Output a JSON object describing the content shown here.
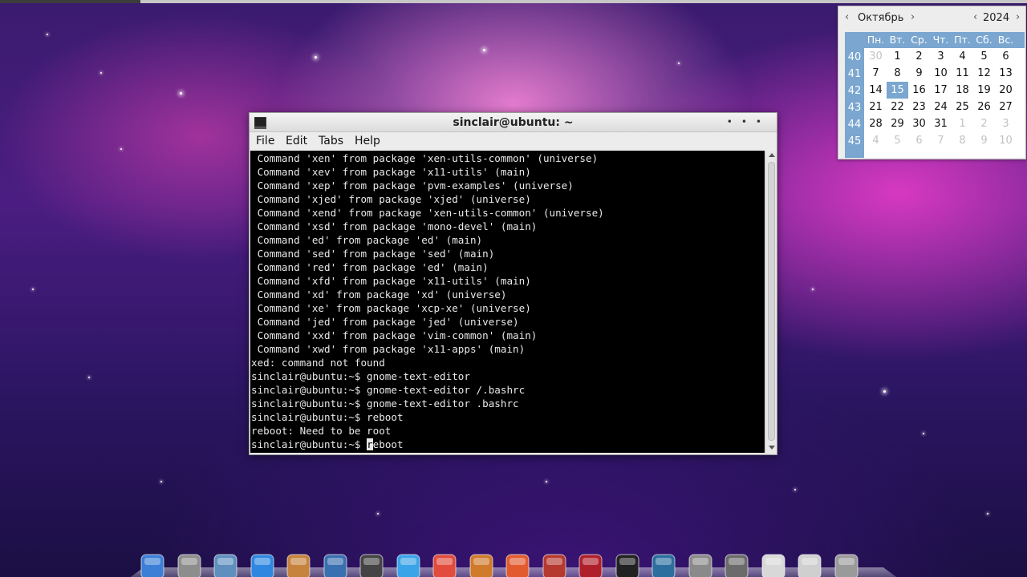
{
  "calendar": {
    "month": "Октябрь",
    "year": "2024",
    "prev_label": "‹",
    "next_label": "›",
    "weekdays": [
      "Пн.",
      "Вт.",
      "Ср.",
      "Чт.",
      "Пт.",
      "Сб.",
      "Вс."
    ],
    "week_numbers": [
      "40",
      "41",
      "42",
      "43",
      "44",
      "45"
    ],
    "rows": [
      [
        "30",
        "1",
        "2",
        "3",
        "4",
        "5",
        "6"
      ],
      [
        "7",
        "8",
        "9",
        "10",
        "11",
        "12",
        "13"
      ],
      [
        "14",
        "15",
        "16",
        "17",
        "18",
        "19",
        "20"
      ],
      [
        "21",
        "22",
        "23",
        "24",
        "25",
        "26",
        "27"
      ],
      [
        "28",
        "29",
        "30",
        "31",
        "1",
        "2",
        "3"
      ],
      [
        "4",
        "5",
        "6",
        "7",
        "8",
        "9",
        "10"
      ]
    ],
    "today": "15"
  },
  "terminal": {
    "title": "sinclair@ubuntu: ~",
    "menu": [
      "File",
      "Edit",
      "Tabs",
      "Help"
    ],
    "lines": [
      " Command 'xen' from package 'xen-utils-common' (universe)",
      " Command 'xev' from package 'x11-utils' (main)",
      " Command 'xep' from package 'pvm-examples' (universe)",
      " Command 'xjed' from package 'xjed' (universe)",
      " Command 'xend' from package 'xen-utils-common' (universe)",
      " Command 'xsd' from package 'mono-devel' (main)",
      " Command 'ed' from package 'ed' (main)",
      " Command 'sed' from package 'sed' (main)",
      " Command 'red' from package 'ed' (main)",
      " Command 'xfd' from package 'x11-utils' (main)",
      " Command 'xd' from package 'xd' (universe)",
      " Command 'xe' from package 'xcp-xe' (universe)",
      " Command 'jed' from package 'jed' (universe)",
      " Command 'xxd' from package 'vim-common' (main)",
      " Command 'xwd' from package 'x11-apps' (main)",
      "xed: command not found",
      "sinclair@ubuntu:~$ gnome-text-editor",
      "sinclair@ubuntu:~$ gnome-text-editor /.bashrc",
      "sinclair@ubuntu:~$ gnome-text-editor .bashrc",
      "sinclair@ubuntu:~$ reboot",
      "reboot: Need to be root"
    ],
    "prompt": "sinclair@ubuntu:~$ ",
    "input_cursor_char": "r",
    "input_rest": "eboot"
  },
  "dock": {
    "icons": [
      "finder-icon",
      "calculator-icon",
      "preview-icon",
      "safari-icon",
      "photos-icon",
      "video-editor-icon",
      "headphones-icon",
      "itunes-icon",
      "calendar-icon",
      "photo-booth-icon",
      "code-editor-icon",
      "joystick-icon",
      "photo-album-icon",
      "terminal-icon",
      "activity-monitor-icon",
      "system-preferences-icon",
      "disk-utility-icon",
      "user-accounts-icon",
      "network-utility-icon",
      "trash-icon"
    ]
  },
  "colors": {
    "calendar_accent": "#7aa6cf",
    "terminal_bg": "#000000",
    "terminal_fg": "#e8e8e8"
  }
}
